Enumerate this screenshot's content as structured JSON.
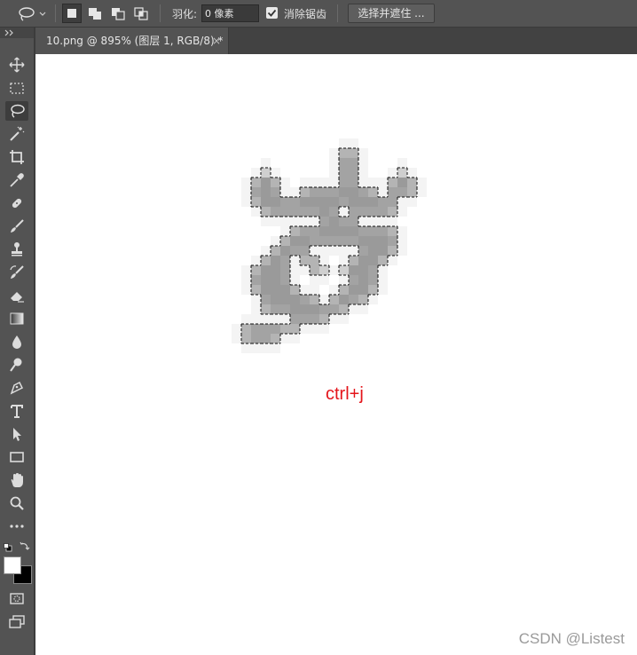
{
  "options_bar": {
    "feather_label": "羽化:",
    "feather_value": "0 像素",
    "antialias_label": "消除锯齿",
    "antialias_checked": true,
    "select_mask_label": "选择并遮住 ..."
  },
  "document_tab": {
    "title": "10.png @ 895% (图层 1, RGB/8) *",
    "close_glyph": "×"
  },
  "canvas": {
    "annotation": "ctrl+j",
    "annotation_color": "#e4141a",
    "watermark": "CSDN @Listest"
  },
  "toolbar": {
    "tools": [
      "move-icon",
      "marquee-icon",
      "lasso-icon",
      "magic-wand-icon",
      "crop-icon",
      "eyedropper-icon",
      "healing-brush-icon",
      "brush-icon",
      "clone-stamp-icon",
      "history-brush-icon",
      "eraser-icon",
      "gradient-icon",
      "blur-icon",
      "dodge-icon",
      "pen-icon",
      "type-icon",
      "path-selection-icon",
      "rectangle-icon",
      "hand-icon",
      "zoom-icon",
      "more-tools-icon"
    ],
    "active_tool": "lasso-icon",
    "foreground_color": "#ffffff",
    "background_color": "#000000"
  },
  "colors": {
    "panel": "#535353",
    "canvas": "#ffffff"
  }
}
